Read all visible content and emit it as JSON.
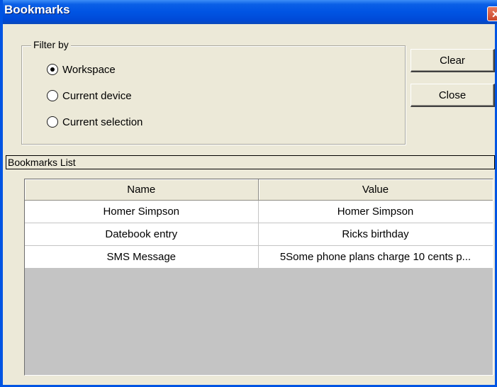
{
  "window": {
    "title": "Bookmarks",
    "close_symbol": "✕"
  },
  "filter": {
    "legend": "Filter by",
    "options": [
      {
        "label": "Workspace",
        "selected": true
      },
      {
        "label": "Current device",
        "selected": false
      },
      {
        "label": "Current selection",
        "selected": false
      }
    ]
  },
  "buttons": {
    "clear_label": "Clear",
    "close_label": "Close"
  },
  "bookmarks": {
    "list_title": "Bookmarks List",
    "columns": [
      "Name",
      "Value"
    ],
    "rows": [
      {
        "name": "Homer Simpson",
        "value": "Homer Simpson"
      },
      {
        "name": "Datebook entry",
        "value": "Ricks birthday"
      },
      {
        "name": "SMS Message",
        "value": "5Some phone plans charge 10 cents p..."
      }
    ]
  },
  "colors": {
    "titlebar": "#0054e3",
    "window_bg": "#ece9d8",
    "grid_empty": "#c4c4c4"
  }
}
